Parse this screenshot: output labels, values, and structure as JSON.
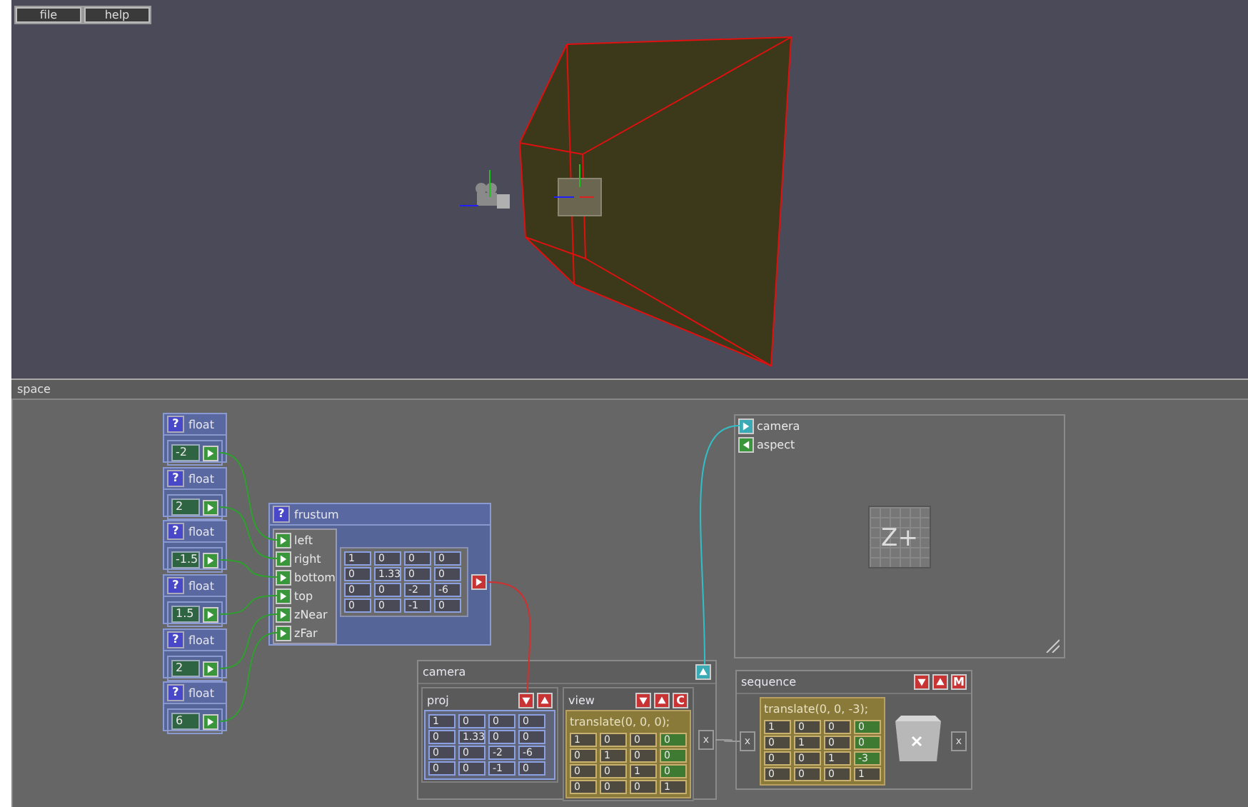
{
  "menu": [
    {
      "label": "file"
    },
    {
      "label": "help"
    }
  ],
  "panel": {
    "title": "space"
  },
  "nodes": [
    {
      "kind": "float",
      "help": "?",
      "title": "float",
      "value": "-2"
    },
    {
      "kind": "float",
      "help": "?",
      "title": "float",
      "value": "2"
    },
    {
      "kind": "float",
      "help": "?",
      "title": "float",
      "value": "-1.5"
    },
    {
      "kind": "float",
      "help": "?",
      "title": "float",
      "value": "1.5"
    },
    {
      "kind": "float",
      "help": "?",
      "title": "float",
      "value": "2"
    },
    {
      "kind": "float",
      "help": "?",
      "title": "float",
      "value": "6"
    },
    {
      "kind": "frustum",
      "help": "?",
      "title": "frustum",
      "inputs": [
        "left",
        "right",
        "bottom",
        "top",
        "zNear",
        "zFar"
      ],
      "matrix": [
        [
          "1",
          "0",
          "0",
          "0"
        ],
        [
          "0",
          "1.33",
          "0",
          "0"
        ],
        [
          "0",
          "0",
          "-2",
          "-6"
        ],
        [
          "0",
          "0",
          "-1",
          "0"
        ]
      ]
    },
    {
      "kind": "camera",
      "title": "camera",
      "proj": {
        "title": "proj",
        "matrix": [
          [
            "1",
            "0",
            "0",
            "0"
          ],
          [
            "0",
            "1.33",
            "0",
            "0"
          ],
          [
            "0",
            "0",
            "-2",
            "-6"
          ],
          [
            "0",
            "0",
            "-1",
            "0"
          ]
        ]
      },
      "view": {
        "title": "view",
        "clear": "C",
        "expression": "translate(0, 0, 0);",
        "matrix": [
          [
            {
              "value": "1",
              "highlighted": false
            },
            {
              "value": "0",
              "highlighted": false
            },
            {
              "value": "0",
              "highlighted": false
            },
            {
              "value": "0",
              "highlighted": true
            }
          ],
          [
            {
              "value": "0",
              "highlighted": false
            },
            {
              "value": "1",
              "highlighted": false
            },
            {
              "value": "0",
              "highlighted": false
            },
            {
              "value": "0",
              "highlighted": true
            }
          ],
          [
            {
              "value": "0",
              "highlighted": false
            },
            {
              "value": "0",
              "highlighted": false
            },
            {
              "value": "1",
              "highlighted": false
            },
            {
              "value": "0",
              "highlighted": true
            }
          ],
          [
            {
              "value": "0",
              "highlighted": false
            },
            {
              "value": "0",
              "highlighted": false
            },
            {
              "value": "0",
              "highlighted": false
            },
            {
              "value": "1",
              "highlighted": false
            }
          ]
        ]
      },
      "port": "x"
    },
    {
      "kind": "viewer",
      "ports": [
        {
          "label": "camera",
          "color": "#3aaab4",
          "kind": "input"
        },
        {
          "label": "aspect",
          "color": "#3a963a",
          "kind": "output"
        }
      ],
      "icon_label": "Z+"
    },
    {
      "kind": "sequence",
      "title": "sequence",
      "mode": "M",
      "in_port": "x",
      "expression": "translate(0, 0, -3);",
      "matrix": [
        [
          {
            "value": "1",
            "highlighted": false
          },
          {
            "value": "0",
            "highlighted": false
          },
          {
            "value": "0",
            "highlighted": false
          },
          {
            "value": "0",
            "highlighted": true
          }
        ],
        [
          {
            "value": "0",
            "highlighted": false
          },
          {
            "value": "1",
            "highlighted": false
          },
          {
            "value": "0",
            "highlighted": false
          },
          {
            "value": "0",
            "highlighted": true
          }
        ],
        [
          {
            "value": "0",
            "highlighted": false
          },
          {
            "value": "0",
            "highlighted": false
          },
          {
            "value": "1",
            "highlighted": false
          },
          {
            "value": "-3",
            "highlighted": true
          }
        ],
        [
          {
            "value": "0",
            "highlighted": false
          },
          {
            "value": "0",
            "highlighted": false
          },
          {
            "value": "0",
            "highlighted": false
          },
          {
            "value": "1",
            "highlighted": false
          }
        ]
      ],
      "out_port": "x"
    }
  ]
}
